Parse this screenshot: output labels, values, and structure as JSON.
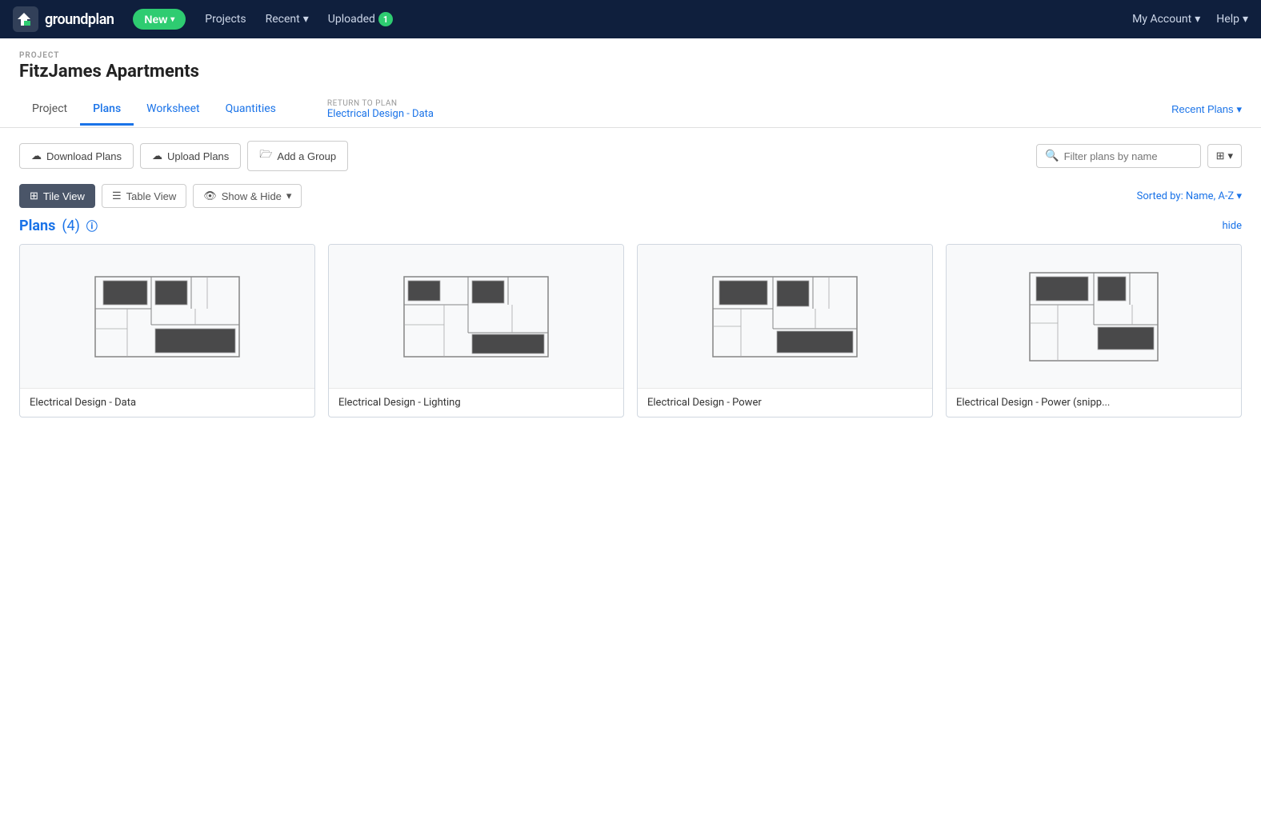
{
  "navbar": {
    "logo_text": "groundplan",
    "new_btn": "New",
    "nav_projects": "Projects",
    "nav_recent": "Recent",
    "nav_recent_caret": "▾",
    "nav_uploaded": "Uploaded",
    "nav_uploaded_badge": "1",
    "my_account": "My Account",
    "my_account_caret": "▾",
    "help": "Help",
    "help_caret": "▾"
  },
  "project": {
    "label": "PROJECT",
    "title": "FitzJames Apartments"
  },
  "tabs": [
    {
      "id": "project",
      "label": "Project",
      "active": false
    },
    {
      "id": "plans",
      "label": "Plans",
      "active": true
    },
    {
      "id": "worksheet",
      "label": "Worksheet",
      "active": false
    },
    {
      "id": "quantities",
      "label": "Quantities",
      "active": false
    }
  ],
  "return_to_plan": {
    "label": "RETURN TO PLAN",
    "link": "Electrical Design - Data"
  },
  "recent_plans_btn": "Recent Plans",
  "toolbar": {
    "download_plans": "Download Plans",
    "upload_plans": "Upload Plans",
    "add_group": "Add a Group",
    "filter_placeholder": "Filter plans by name"
  },
  "view_toggle": {
    "tile_view": "Tile View",
    "table_view": "Table View",
    "show_hide": "Show & Hide",
    "sorted_by": "Sorted by: Name, A-Z"
  },
  "plans_section": {
    "title": "Plans",
    "count": "(4)",
    "hide_label": "hide"
  },
  "plans": [
    {
      "id": 1,
      "name": "Electrical Design - Data"
    },
    {
      "id": 2,
      "name": "Electrical Design - Lighting"
    },
    {
      "id": 3,
      "name": "Electrical Design - Power"
    },
    {
      "id": 4,
      "name": "Electrical Design - Power (snipp..."
    }
  ]
}
